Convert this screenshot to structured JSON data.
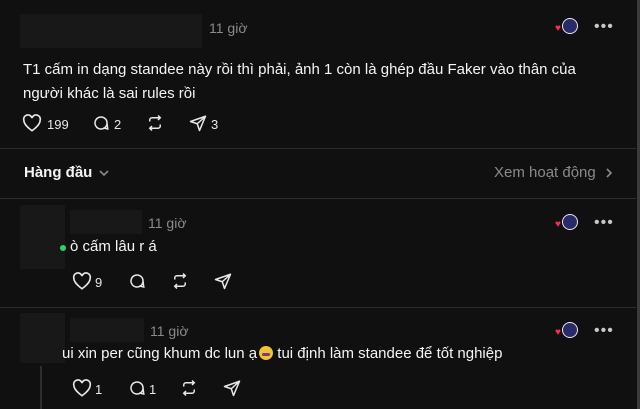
{
  "post": {
    "time": "11 giờ",
    "text": "T1 cấm in dạng standee này rồi thì phải, ảnh 1 còn là ghép đầu Faker vào thân của người khác là sai rules rồi",
    "likes": "199",
    "comments": "2",
    "shares": "3"
  },
  "sort_bar": {
    "sort_label": "Hàng đầu",
    "activity_label": "Xem hoạt động"
  },
  "replies": [
    {
      "time": "11 giờ",
      "text": "ò cấm lâu r á",
      "likes": "9"
    },
    {
      "time": "11 giờ",
      "text_before": "ui xin per cũng khum dc lun ạ",
      "text_after": " tui định làm standee để tốt nghiệp",
      "likes": "1",
      "comments": "1"
    }
  ],
  "icons": {
    "like": "heart-icon",
    "comment": "comment-icon",
    "repost": "repost-icon",
    "share": "send-icon",
    "more": "more-icon",
    "chevron": "chevron-icon",
    "avatar_badge": "like-badge-icon"
  },
  "colors": {
    "background": "#101010",
    "text": "#f3f5f7",
    "muted": "#8a8a8a",
    "like_red": "#ff2a55"
  }
}
